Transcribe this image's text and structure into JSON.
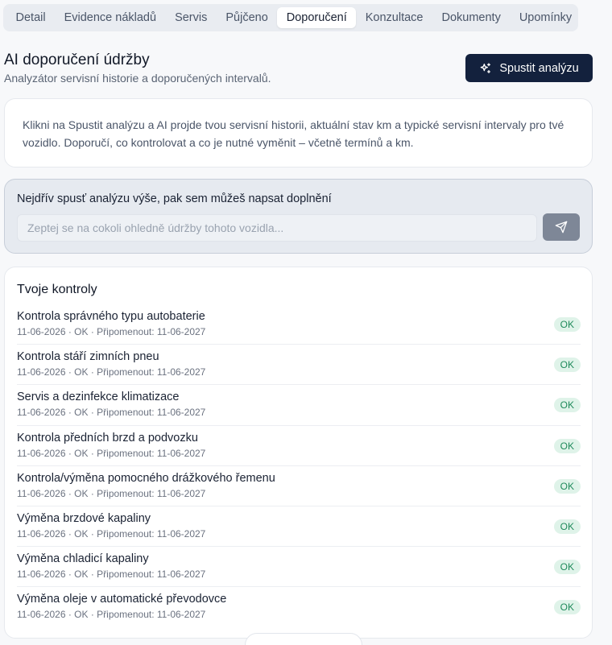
{
  "tabs": [
    {
      "label": "Detail",
      "active": false
    },
    {
      "label": "Evidence nákladů",
      "active": false
    },
    {
      "label": "Servis",
      "active": false
    },
    {
      "label": "Půjčeno",
      "active": false
    },
    {
      "label": "Doporučení",
      "active": true
    },
    {
      "label": "Konzultace",
      "active": false
    },
    {
      "label": "Dokumenty",
      "active": false
    },
    {
      "label": "Upomínky",
      "active": false
    }
  ],
  "header": {
    "title": "AI doporučení údržby",
    "subtitle": "Analyzátor servisní historie a doporučených intervalů.",
    "run_button_label": "Spustit analýzu",
    "run_button_icon": "sparkles-icon"
  },
  "info": {
    "text": "Klikni na Spustit analýzu a AI projde tvou servisní historii, aktuální stav km a typické servisní intervaly pro tvé vozidlo. Doporučí, co kontrolovat a co je nutné vyměnit – včetně termínů a km."
  },
  "chat": {
    "title": "Nejdřív spusť analýzu výše, pak sem můžeš napsat doplnění",
    "placeholder": "Zeptej se na cokoli ohledně údržby tohoto vozidla...",
    "value": "",
    "send_icon": "send-icon"
  },
  "checks": {
    "title": "Tvoje kontroly",
    "items": [
      {
        "name": "Kontrola správného typu autobaterie",
        "meta": "11-06-2026 · OK · Připomenout: 11-06-2027",
        "status": "OK"
      },
      {
        "name": "Kontrola stáří zimních pneu",
        "meta": "11-06-2026 · OK · Připomenout: 11-06-2027",
        "status": "OK"
      },
      {
        "name": "Servis a dezinfekce klimatizace",
        "meta": "11-06-2026 · OK · Připomenout: 11-06-2027",
        "status": "OK"
      },
      {
        "name": "Kontrola předních brzd a podvozku",
        "meta": "11-06-2026 · OK · Připomenout: 11-06-2027",
        "status": "OK"
      },
      {
        "name": "Kontrola/výměna pomocného drážkového řemenu",
        "meta": "11-06-2026 · OK · Připomenout: 11-06-2027",
        "status": "OK"
      },
      {
        "name": "Výměna brzdové kapaliny",
        "meta": "11-06-2026 · OK · Připomenout: 11-06-2027",
        "status": "OK"
      },
      {
        "name": "Výměna chladicí kapaliny",
        "meta": "11-06-2026 · OK · Připomenout: 11-06-2027",
        "status": "OK"
      },
      {
        "name": "Výměna oleje v automatické převodovce",
        "meta": "11-06-2026 · OK · Připomenout: 11-06-2027",
        "status": "OK"
      }
    ]
  },
  "colors": {
    "primary": "#13213d",
    "ok_badge_bg": "#dff3e9",
    "ok_badge_text": "#1f8a5b",
    "send_button": "#7e8797"
  }
}
